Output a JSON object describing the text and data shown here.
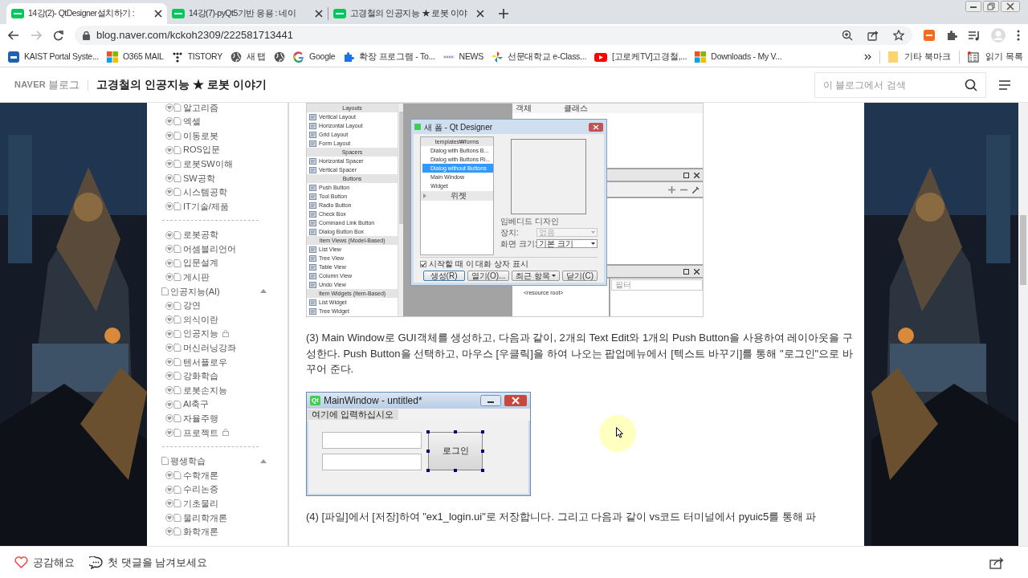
{
  "browser": {
    "tabs": [
      {
        "title": "14강(2)- QtDesigner설치하기 :",
        "selected": true
      },
      {
        "title": "14강(7)-pyQt5기반 응용 : 네이",
        "selected": false
      },
      {
        "title": "고경철의 인공지능 ★ 로봇 이야",
        "selected": false
      }
    ],
    "url": "blog.naver.com/kckoh2309/222581713441",
    "bookmarks": [
      {
        "kind": "kaist",
        "label": "KAIST Portal Syste..."
      },
      {
        "kind": "windows",
        "label": "O365 MAIL"
      },
      {
        "kind": "tistory",
        "label": "TISTORY"
      },
      {
        "kind": "globe",
        "label": "새 탭"
      },
      {
        "kind": "globe"
      },
      {
        "kind": "google",
        "label": "Google"
      },
      {
        "kind": "puzzle",
        "label": "확장 프로그램 - To..."
      },
      {
        "kind": "news",
        "label": "NEWS"
      },
      {
        "kind": "pinwheel",
        "label": "선문대학교 e-Class..."
      },
      {
        "kind": "youtube",
        "label": "[고로케TV]고경철,..."
      },
      {
        "kind": "windows",
        "label": "Downloads - My V..."
      }
    ],
    "other_bookmarks": "기타 북마크",
    "reading_list": "읽기 목록"
  },
  "blog_header": {
    "brand": "NAVER",
    "brand_sub": "블로그",
    "title": "고경철의 인공지능 ★ 로봇 이야기",
    "search_placeholder": "이 블로그에서 검색"
  },
  "sidebar": {
    "sections": [
      {
        "items": [
          {
            "kind": "post",
            "label": "알고리즘",
            "locked": false
          },
          {
            "kind": "post",
            "label": "엑셀",
            "locked": false
          },
          {
            "kind": "post",
            "label": "이동로봇",
            "locked": false
          },
          {
            "kind": "post",
            "label": "ROS입문",
            "locked": false
          },
          {
            "kind": "post",
            "label": "로봇SW이해",
            "locked": false
          },
          {
            "kind": "post",
            "label": "SW공학",
            "locked": false
          },
          {
            "kind": "post",
            "label": "시스템공학",
            "locked": false
          },
          {
            "kind": "post",
            "label": "IT기술/제품",
            "locked": false
          }
        ]
      },
      {
        "items": [
          {
            "kind": "post",
            "label": "로봇공학",
            "locked": false
          },
          {
            "kind": "post",
            "label": "어셈블리언어",
            "locked": false
          },
          {
            "kind": "post",
            "label": "입문설계",
            "locked": false
          },
          {
            "kind": "post",
            "label": "게시판",
            "locked": false
          },
          {
            "kind": "category",
            "label": "인공지능(AI)",
            "expanded": true,
            "children": [
              {
                "kind": "post",
                "label": "강연",
                "locked": false
              },
              {
                "kind": "post",
                "label": "의식이란",
                "locked": false
              },
              {
                "kind": "post",
                "label": "인공지능",
                "locked": true
              },
              {
                "kind": "post",
                "label": "머신러닝강좌",
                "locked": false
              },
              {
                "kind": "post",
                "label": "텐서플로우",
                "locked": false
              },
              {
                "kind": "post",
                "label": "강화학습",
                "locked": false
              },
              {
                "kind": "post",
                "label": "로봇손지능",
                "locked": false
              },
              {
                "kind": "post",
                "label": "AI축구",
                "locked": false
              },
              {
                "kind": "post",
                "label": "자율주행",
                "locked": false
              },
              {
                "kind": "post",
                "label": "프로젝트",
                "locked": true
              }
            ]
          }
        ]
      },
      {
        "items": [
          {
            "kind": "category",
            "label": "평생학습",
            "expanded": true,
            "children": [
              {
                "kind": "post",
                "label": "수학개론",
                "locked": false
              },
              {
                "kind": "post",
                "label": "수리논증",
                "locked": false
              },
              {
                "kind": "post",
                "label": "기초물리",
                "locked": false
              },
              {
                "kind": "post",
                "label": "물리학개론",
                "locked": false
              },
              {
                "kind": "post",
                "label": "화학개론",
                "locked": false
              }
            ]
          }
        ]
      }
    ]
  },
  "article": {
    "blocks": [
      {
        "kind": "qt_designer",
        "widget_box": [
          {
            "title": "Layouts",
            "items": [
              "Vertical Layout",
              "Horizontal Layout",
              "Grid Layout",
              "Form Layout"
            ]
          },
          {
            "title": "Spacers",
            "items": [
              "Horizontal Spacer",
              "Vertical Spacer"
            ]
          },
          {
            "title": "Buttons",
            "items": [
              "Push Button",
              "Tool Button",
              "Radio Button",
              "Check Box",
              "Command Link Button",
              "Dialog Button Box"
            ]
          },
          {
            "title": "Item Views (Model-Based)",
            "items": [
              "List View",
              "Tree View",
              "Table View",
              "Column View",
              "Undo View"
            ]
          },
          {
            "title": "Item Widgets (Item-Based)",
            "items": [
              "List Widget",
              "Tree Widget"
            ]
          }
        ],
        "inspector_columns": [
          "객체",
          "클래스"
        ],
        "filter_placeholder": "필터",
        "resource_root": "<resource root>",
        "dialog": {
          "title": "새 폼 - Qt Designer",
          "tree_header": "templates₩forms",
          "templates": [
            {
              "label": "Dialog with Buttons B...",
              "selected": false
            },
            {
              "label": "Dialog with Buttons Ri...",
              "selected": false
            },
            {
              "label": "Dialog without Buttons",
              "selected": true
            },
            {
              "label": "Main Window",
              "selected": false
            },
            {
              "label": "Widget",
              "selected": false
            }
          ],
          "collapsed_group": "위젯",
          "embedded_design": "임베디드 디자인",
          "device": {
            "label": "장치:",
            "value": "없음",
            "disabled": true
          },
          "screen_size": {
            "label": "화면 크기:",
            "value": "기본 크기",
            "disabled": false
          },
          "show_on_startup": {
            "label": "시작할 때 이 대화 상자 표시",
            "checked": true
          },
          "buttons": [
            {
              "kind": "default",
              "label": "생성(R)"
            },
            {
              "kind": "plain",
              "label": "열기(O)..."
            },
            {
              "kind": "menu",
              "label": "최근 항목"
            },
            {
              "kind": "plain",
              "label": "닫기(C)"
            }
          ]
        }
      },
      {
        "kind": "paragraph",
        "text": "(3) Main Window로 GUI객체를 생성하고, 다음과 같이, 2개의 Text Edit와 1개의 Push Button을 사용하여 레이아웃을 구성한다. Push Button을 선택하고, 마우스 [우클릭]을 하여 나오는 팝업메뉴에서 [텍스트 바꾸기]를 통해 \"로그인\"으로 바꾸어 준다."
      },
      {
        "kind": "main_window",
        "logo": "Qt",
        "title": "MainWindow - untitled*",
        "menu_placeholder": "여기에 입력하십시오",
        "button": "로그인"
      },
      {
        "kind": "paragraph",
        "text": "(4) [파일]에서 [저장]하여 \"ex1_login.ui\"로 저장합니다. 그리고 다음과 같이 vs코드 터미널에서 pyuic5를 통해 파"
      }
    ]
  },
  "footer": {
    "like": "공감해요",
    "comment": "첫 댓글을 남겨보세요"
  }
}
